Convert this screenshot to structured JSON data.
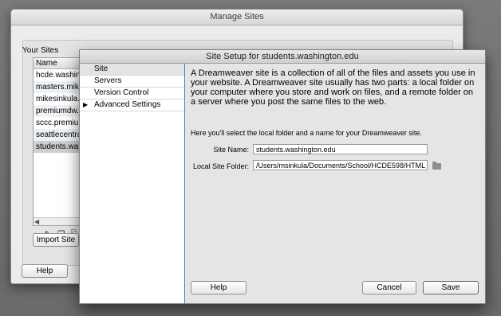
{
  "manage_sites": {
    "title": "Manage Sites",
    "group_label": "Your Sites",
    "column_header": "Name",
    "sites": [
      "hcde.washingt",
      "masters.mikes",
      "mikesinkula.co",
      "premiumdw.co",
      "sccc.premium",
      "seattlecentral",
      "students.wash"
    ],
    "selected_index": 6,
    "import_button": "Import Site",
    "help_button": "Help",
    "tool_icons": [
      "minus-icon",
      "pencil-icon",
      "duplicate-icon",
      "export-icon"
    ]
  },
  "site_setup": {
    "title": "Site Setup for students.washington.edu",
    "sidebar": [
      {
        "label": "Site",
        "selected": true,
        "expandable": false
      },
      {
        "label": "Servers",
        "selected": false,
        "expandable": false
      },
      {
        "label": "Version Control",
        "selected": false,
        "expandable": false
      },
      {
        "label": "Advanced Settings",
        "selected": false,
        "expandable": true
      }
    ],
    "intro_text": "A Dreamweaver site is a collection of all of the files and assets you use in your website. A Dreamweaver site usually has two parts: a local folder on your computer where you store and work on files, and a remote folder on a server where you post the same files to the web.",
    "sub_text": "Here you'll select the local folder and a name for your Dreamweaver site.",
    "site_name_label": "Site Name:",
    "site_name_value": "students.washington.edu",
    "local_folder_label": "Local Site Folder:",
    "local_folder_value": "/Users/msinkula/Documents/School/HCDE598/HTML",
    "help_button": "Help",
    "cancel_button": "Cancel",
    "save_button": "Save"
  }
}
